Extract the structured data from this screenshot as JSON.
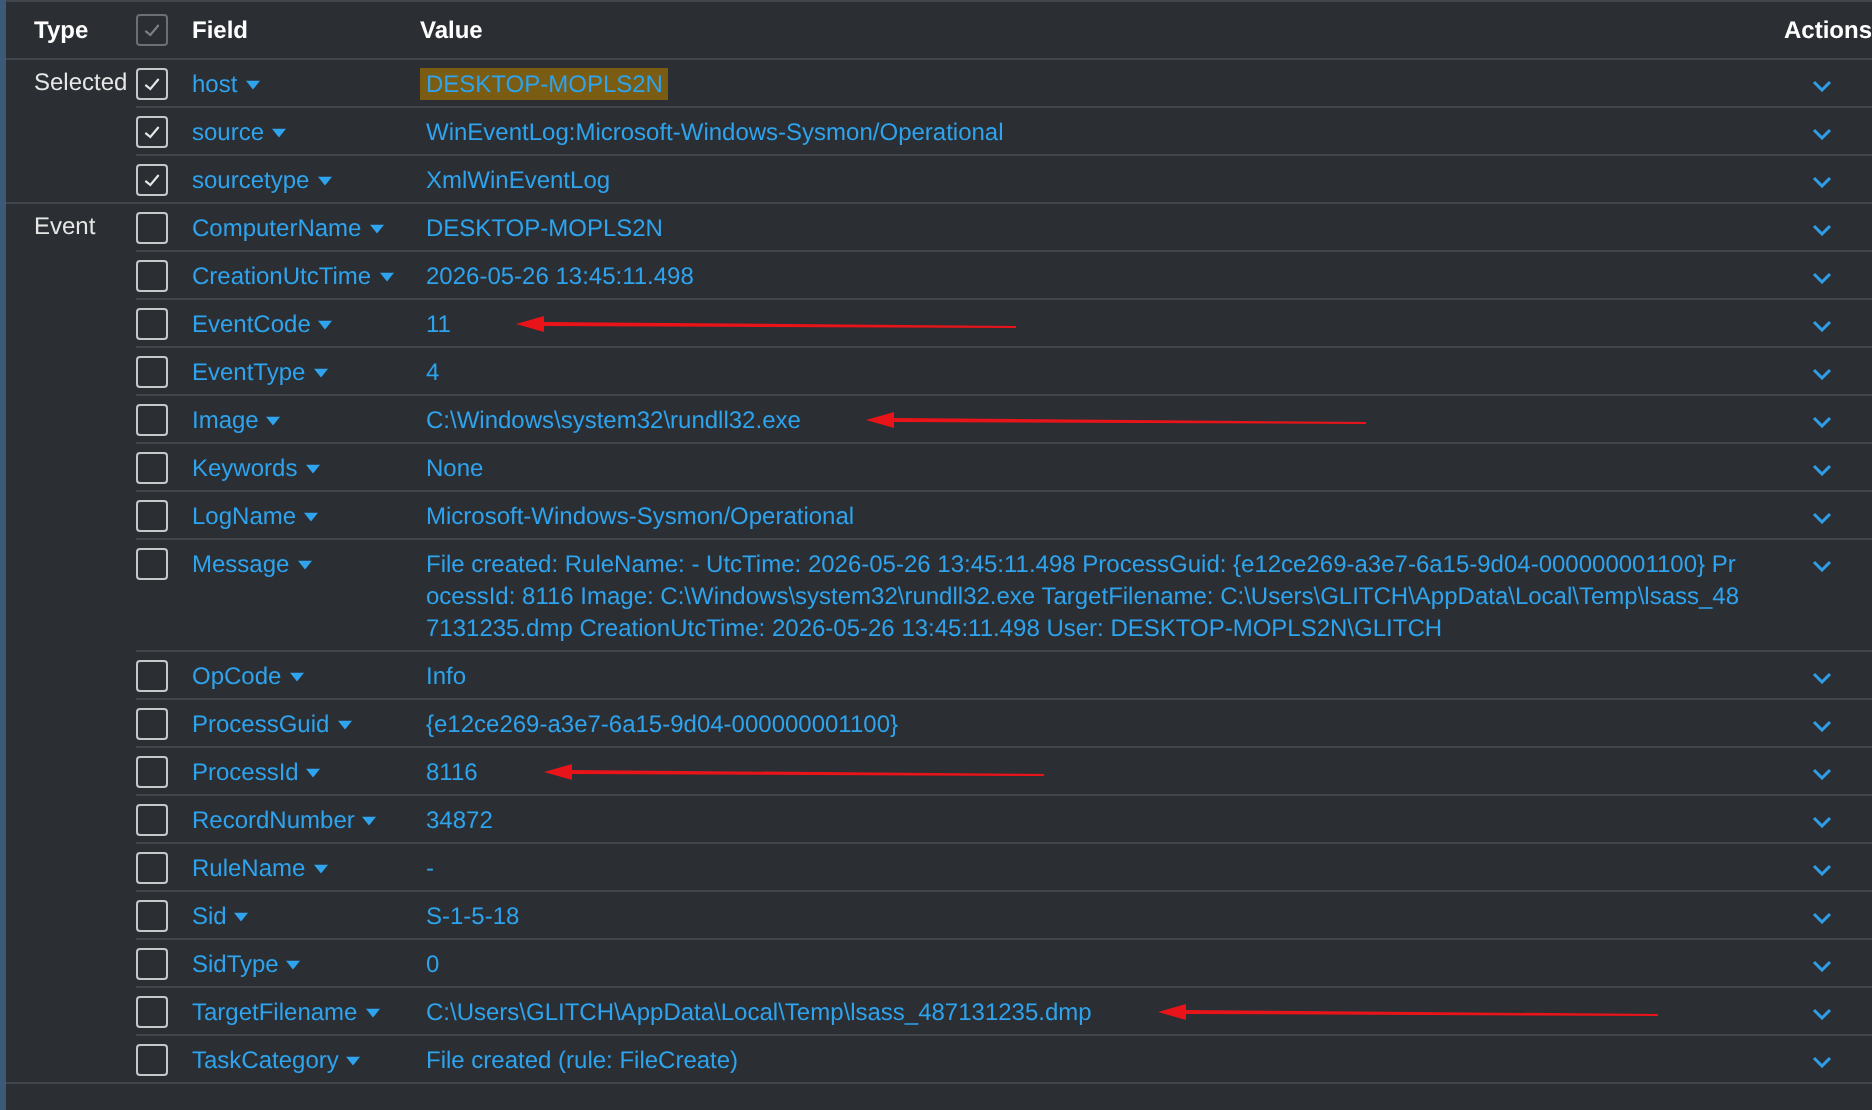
{
  "header": {
    "type": "Type",
    "checkbox_checked": true,
    "field": "Field",
    "value": "Value",
    "actions": "Actions"
  },
  "groups": [
    {
      "type": "Selected",
      "rows": [
        {
          "field": "host",
          "value": "DESKTOP-MOPLS2N",
          "checked": true,
          "highlighted": true,
          "arrow": false
        },
        {
          "field": "source",
          "value": "WinEventLog:Microsoft-Windows-Sysmon/Operational",
          "checked": true,
          "highlighted": false,
          "arrow": false
        },
        {
          "field": "sourcetype",
          "value": "XmlWinEventLog",
          "checked": true,
          "highlighted": false,
          "arrow": false
        }
      ]
    },
    {
      "type": "Event",
      "rows": [
        {
          "field": "ComputerName",
          "value": "DESKTOP-MOPLS2N",
          "checked": false,
          "highlighted": false,
          "arrow": false
        },
        {
          "field": "CreationUtcTime",
          "value": "2026-05-26 13:45:11.498",
          "checked": false,
          "highlighted": false,
          "arrow": false
        },
        {
          "field": "EventCode",
          "value": "11",
          "checked": false,
          "highlighted": false,
          "arrow": true
        },
        {
          "field": "EventType",
          "value": "4",
          "checked": false,
          "highlighted": false,
          "arrow": false
        },
        {
          "field": "Image",
          "value": "C:\\Windows\\system32\\rundll32.exe",
          "checked": false,
          "highlighted": false,
          "arrow": true
        },
        {
          "field": "Keywords",
          "value": "None",
          "checked": false,
          "highlighted": false,
          "arrow": false
        },
        {
          "field": "LogName",
          "value": "Microsoft-Windows-Sysmon/Operational",
          "checked": false,
          "highlighted": false,
          "arrow": false
        },
        {
          "field": "Message",
          "value": "File created: RuleName: - UtcTime: 2026-05-26 13:45:11.498 ProcessGuid: {e12ce269-a3e7-6a15-9d04-000000001100} ProcessId: 8116 Image: C:\\Windows\\system32\\rundll32.exe TargetFilename: C:\\Users\\GLITCH\\AppData\\Local\\Temp\\lsass_487131235.dmp CreationUtcTime: 2026-05-26 13:45:11.498 User: DESKTOP-MOPLS2N\\GLITCH",
          "checked": false,
          "highlighted": false,
          "arrow": false
        },
        {
          "field": "OpCode",
          "value": "Info",
          "checked": false,
          "highlighted": false,
          "arrow": false
        },
        {
          "field": "ProcessGuid",
          "value": "{e12ce269-a3e7-6a15-9d04-000000001100}",
          "checked": false,
          "highlighted": false,
          "arrow": false
        },
        {
          "field": "ProcessId",
          "value": "8116",
          "checked": false,
          "highlighted": false,
          "arrow": true
        },
        {
          "field": "RecordNumber",
          "value": "34872",
          "checked": false,
          "highlighted": false,
          "arrow": false
        },
        {
          "field": "RuleName",
          "value": "-",
          "checked": false,
          "highlighted": false,
          "arrow": false
        },
        {
          "field": "Sid",
          "value": "S-1-5-18",
          "checked": false,
          "highlighted": false,
          "arrow": false
        },
        {
          "field": "SidType",
          "value": "0",
          "checked": false,
          "highlighted": false,
          "arrow": false
        },
        {
          "field": "TargetFilename",
          "value": "C:\\Users\\GLITCH\\AppData\\Local\\Temp\\lsass_487131235.dmp",
          "checked": false,
          "highlighted": false,
          "arrow": true
        },
        {
          "field": "TaskCategory",
          "value": "File created (rule: FileCreate)",
          "checked": false,
          "highlighted": false,
          "arrow": false
        }
      ]
    }
  ]
}
